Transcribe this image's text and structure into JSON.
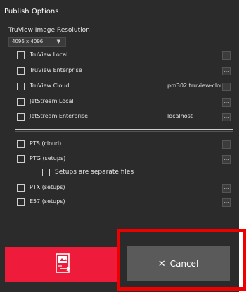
{
  "panel": {
    "title": "Publish Options"
  },
  "resolution": {
    "label": "TruView Image Resolution",
    "selected": "4096 x 4096"
  },
  "truview_rows": [
    {
      "label": "TruView Local",
      "value": "",
      "more": "..."
    },
    {
      "label": "TruView Enterprise",
      "value": "",
      "more": "..."
    },
    {
      "label": "TruView Cloud",
      "value": "pm302.truview-clou...",
      "more": "..."
    },
    {
      "label": "JetStream Local",
      "value": "",
      "more": "..."
    },
    {
      "label": "JetStream Enterprise",
      "value": "localhost",
      "more": "..."
    }
  ],
  "format_rows": [
    {
      "label": "PTS (cloud)",
      "more": "..."
    },
    {
      "label": "PTG (setups)",
      "more": "..."
    },
    {
      "label": "Setups are separate files"
    },
    {
      "label": "PTX (setups)",
      "more": "..."
    },
    {
      "label": "E57 (setups)",
      "more": "..."
    }
  ],
  "buttons": {
    "publish_icon": "publish-export-icon",
    "cancel_label": "Cancel",
    "cancel_icon": "close-icon"
  },
  "colors": {
    "panel_bg": "#2b2b2b",
    "publish_bg": "#ee1c3a",
    "cancel_bg": "#5a5a5a",
    "highlight": "#ee0000"
  }
}
